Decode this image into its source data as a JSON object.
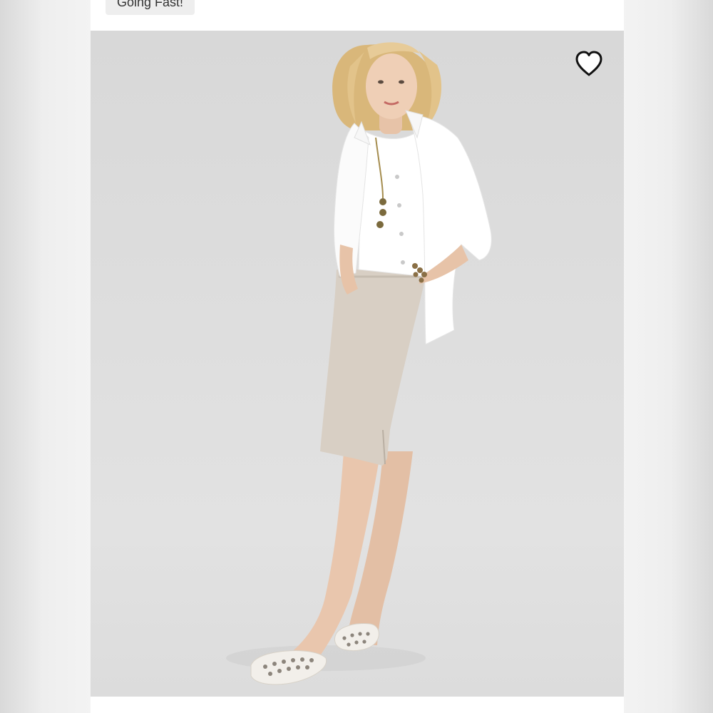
{
  "listing": {
    "badge_label": "Going Fast!"
  },
  "wishlist": {
    "icon": "heart-outline-icon",
    "color": "#111111"
  },
  "product_image": {
    "background_color": "#dcdcdc"
  }
}
